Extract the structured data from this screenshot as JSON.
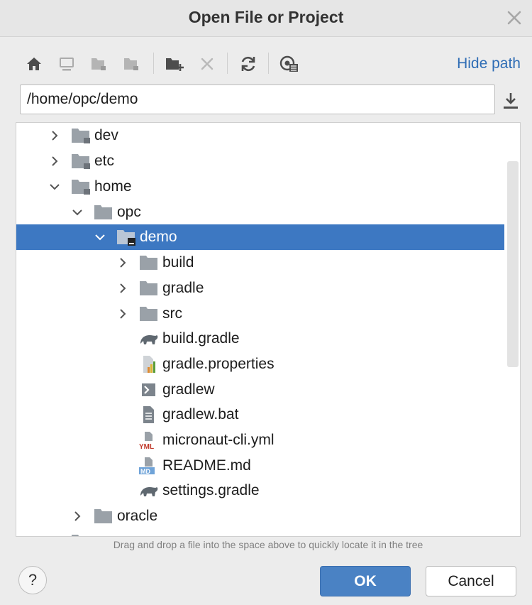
{
  "dialog": {
    "title": "Open File or Project"
  },
  "toolbar": {
    "icons": [
      "home-icon",
      "desktop-icon",
      "project-icon",
      "module-icon",
      "new-folder-icon",
      "delete-icon",
      "refresh-icon",
      "show-hidden-icon"
    ],
    "hide_path_label": "Hide path"
  },
  "path": {
    "value": "/home/opc/demo"
  },
  "tree": {
    "items": [
      {
        "label": "dev",
        "icon": "folder-icon",
        "expanded": false
      },
      {
        "label": "etc",
        "icon": "folder-icon",
        "expanded": false
      },
      {
        "label": "home",
        "icon": "folder-icon",
        "expanded": true
      },
      {
        "label": "opc",
        "icon": "folder-icon",
        "expanded": true
      },
      {
        "label": "demo",
        "icon": "project-folder-icon",
        "expanded": true,
        "selected": true
      },
      {
        "label": "build",
        "icon": "folder-icon",
        "expanded": false
      },
      {
        "label": "gradle",
        "icon": "folder-icon",
        "expanded": false
      },
      {
        "label": "src",
        "icon": "folder-icon",
        "expanded": false
      },
      {
        "label": "build.gradle",
        "icon": "gradle-file-icon"
      },
      {
        "label": "gradle.properties",
        "icon": "properties-file-icon"
      },
      {
        "label": "gradlew",
        "icon": "shell-script-icon"
      },
      {
        "label": "gradlew.bat",
        "icon": "text-file-icon"
      },
      {
        "label": "micronaut-cli.yml",
        "icon": "yml-file-icon"
      },
      {
        "label": "README.md",
        "icon": "markdown-file-icon"
      },
      {
        "label": "settings.gradle",
        "icon": "gradle-file-icon"
      },
      {
        "label": "oracle",
        "icon": "folder-icon",
        "expanded": false
      }
    ]
  },
  "hint": "Drag and drop a file into the space above to quickly locate it in the tree",
  "buttons": {
    "help": "?",
    "ok": "OK",
    "cancel": "Cancel"
  },
  "colors": {
    "selection": "#3d78c2",
    "link": "#2f6db5",
    "ok_button": "#4a82c4",
    "folder": "#9aa1a8"
  }
}
